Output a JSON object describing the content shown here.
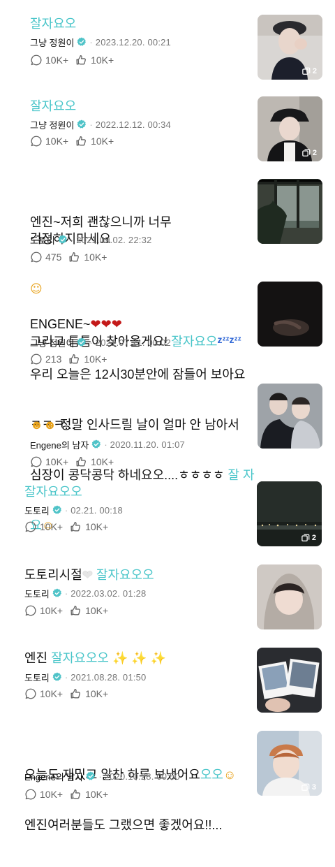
{
  "accent_color": "#49c5c9",
  "posts": [
    {
      "text_plain": "",
      "text_mint": "잘자요오",
      "author": "그냥 정원이",
      "date": "2023.12.20. 00:21",
      "comments": "10K+",
      "likes": "10K+",
      "photo_count": "2"
    },
    {
      "text_plain": "",
      "text_mint": "잘자요오",
      "author": "그냥 정원이",
      "date": "2022.12.12. 00:34",
      "comments": "10K+",
      "likes": "10K+",
      "photo_count": "2"
    },
    {
      "line1": "엔진~저희 괜찮으니까 너무 걱정하지마세요",
      "line3": "그리고 틈틈이 찾아올게요!",
      "text_mint": "잘자요오",
      "author": "도토리",
      "date": "2021.09.02. 22:32",
      "comments": "475",
      "likes": "10K+"
    },
    {
      "line1": "ENGENE~",
      "line2": "우리 오늘은 12시30분안에 잠들어 보아요",
      "line3": "ㅋㅋㅋ...",
      "author": "그냥 정원이",
      "date": "2021.07.21. 00:02",
      "comments": "213",
      "likes": "10K+"
    },
    {
      "line1": "정말 인사드릴 날이 얼마 안 남아서",
      "line2": "심장이 콩닥콩닥 하네요오....ㅎㅎㅎㅎ",
      "mint1": "잘 자",
      "mint2": "요",
      "author": "Engene의 남자",
      "date": "2020.11.20. 01:07",
      "comments": "10K+",
      "likes": "10K+"
    },
    {
      "text_mint": "잘자요오오",
      "author": "도토리",
      "date": "02.21. 00:18",
      "comments": "10K+",
      "likes": "10K+",
      "photo_count": "2"
    },
    {
      "line1": "도토리시절",
      "text_mint": "잘자요오오",
      "author": "도토리",
      "date": "2022.03.02. 01:28",
      "comments": "10K+",
      "likes": "10K+"
    },
    {
      "line1": "엔진",
      "text_mint": "잘자요오오",
      "author": "도토리",
      "date": "2021.08.28. 01:50",
      "comments": "10K+",
      "likes": "10K+"
    },
    {
      "line1": "오늘도 재밌고 알찬 하루 보냈어요",
      "mint1": "오오",
      "line2": "엔진여러분들도  그랬으면 좋겠어요!!...",
      "author": "Engene의 남자",
      "date": "2020.10.28. 00:50",
      "comments": "10K+",
      "likes": "10K+",
      "photo_count": "3"
    }
  ]
}
